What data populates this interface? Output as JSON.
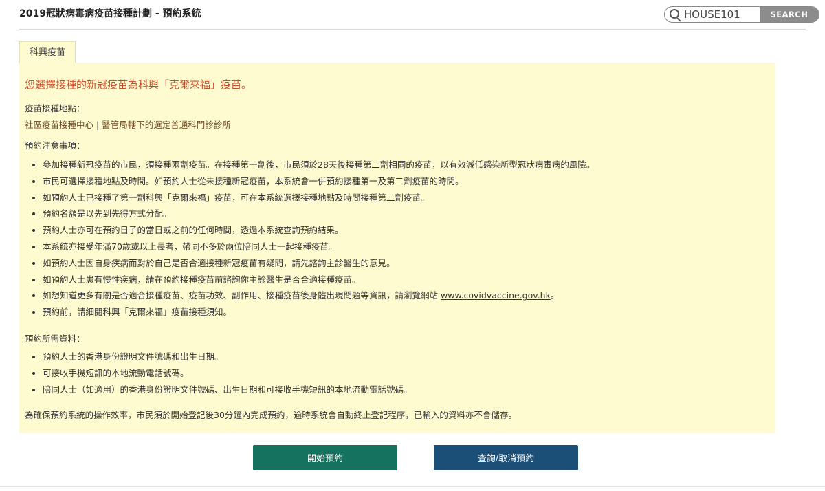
{
  "header": {
    "title": "2019冠狀病毒病疫苗接種計劃 - 預約系統",
    "search": {
      "value": "HOUSE101",
      "button_label": "SEARCH"
    }
  },
  "tab": {
    "label": "科興疫苗"
  },
  "content": {
    "headline": "您選擇接種的新冠疫苗為科興「克爾來福」疫苗。",
    "location_label": "疫苗接種地點：",
    "location_links": [
      "社區疫苗接種中心",
      "醫管局轄下的選定普通科門診診所"
    ],
    "location_separator": "|",
    "notes_label": "預約注意事項：",
    "notes": [
      "參加接種新冠疫苗的市民，須接種兩劑疫苗。在接種第一劑後，市民須於28天後接種第二劑相同的疫苗，以有效減低感染新型冠狀病毒病的風險。",
      "市民可選擇接種地點及時間。如預約人士從未接種新冠疫苗，本系統會一併預約接種第一及第二劑疫苗的時間。",
      "如預約人士已接種了第一劑科興「克爾來福」疫苗，可在本系統選擇接種地點及時間接種第二劑疫苗。",
      "預約名額是以先到先得方式分配。",
      "預約人士亦可在預約日子的當日或之前的任何時間，透過本系統查詢預約結果。",
      "本系統亦接受年滿70歲或以上長者，帶同不多於兩位陪同人士一起接種疫苗。",
      "如預約人士因自身疾病而對於自己是否合適接種新冠疫苗有疑問，請先諮詢主診醫生的意見。",
      "如預約人士患有慢性疾病，請在預約接種疫苗前諮詢你主診醫生是否合適接種疫苗。"
    ],
    "note_website": {
      "text": "如想知道更多有關是否適合接種疫苗、疫苗功效、副作用、接種疫苗後身體出現問題等資訊，請瀏覽網站",
      "link": "www.covidvaccine.gov.hk",
      "suffix": "。"
    },
    "note_last": "預約前，請細閱科興「克爾來福」疫苗接種須知。",
    "required_label": "預約所需資料：",
    "required": [
      "預約人士的香港身份證明文件號碼和出生日期。",
      "可接收手機短訊的本地流動電話號碼。",
      "陪同人士（如適用）的香港身份證明文件號碼、出生日期和可接收手機短訊的本地流動電話號碼。"
    ],
    "footer_note": "為確保預約系統的操作效率，市民須於開始登記後30分鐘內完成預約，逾時系統會自動終止登記程序，已輸入的資料亦不會儲存。"
  },
  "buttons": {
    "start": "開始預約",
    "query": "查詢/取消預約"
  },
  "colors": {
    "panel_bg": "#fffbd1",
    "headline": "#c4512c",
    "start_button": "#14725e",
    "query_button": "#1c4f78"
  }
}
